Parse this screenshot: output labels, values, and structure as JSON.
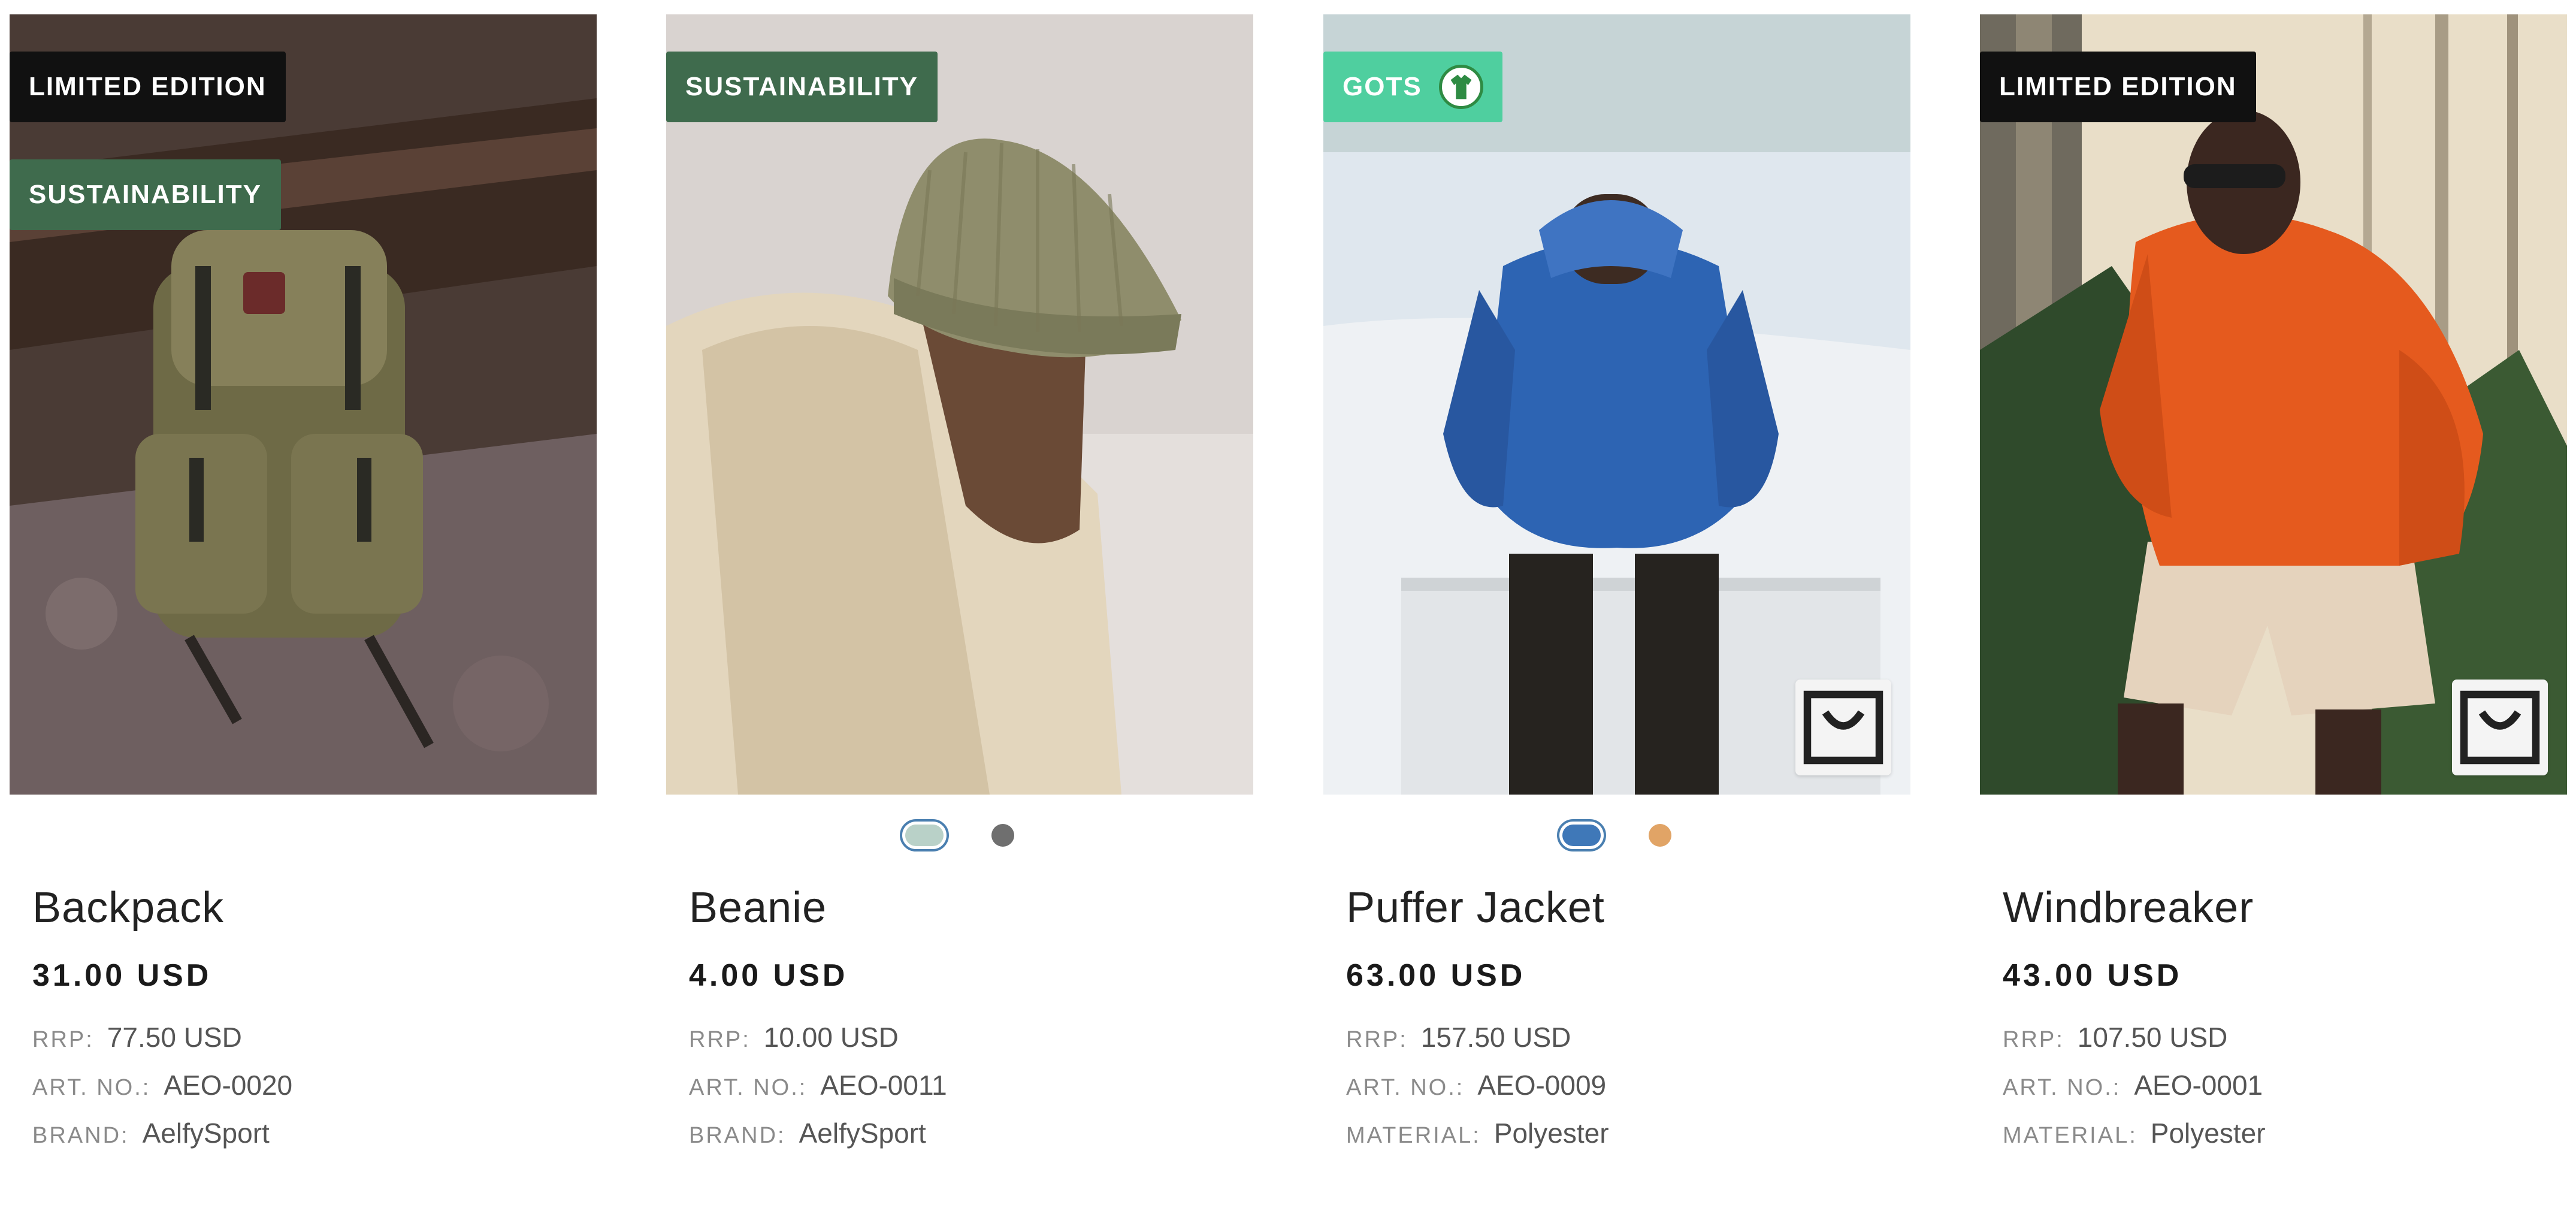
{
  "products": [
    {
      "name": "Backpack",
      "price": "31.00 USD",
      "badges": [
        {
          "label": "LIMITED EDITION",
          "color": "#111111"
        },
        {
          "label": "SUSTAINABILITY",
          "color": "#3f6b4d"
        }
      ],
      "details": [
        {
          "label": "RRP:",
          "value": "77.50 USD"
        },
        {
          "label": "ART. NO.:",
          "value": "AEO-0020"
        },
        {
          "label": "BRAND:",
          "value": "AelfySport"
        }
      ]
    },
    {
      "name": "Beanie",
      "price": "4.00 USD",
      "badges": [
        {
          "label": "SUSTAINABILITY",
          "color": "#3f6b4d"
        }
      ],
      "swatches": [
        "#b9d1c8",
        "#6f6f6f"
      ],
      "details": [
        {
          "label": "RRP:",
          "value": "10.00 USD"
        },
        {
          "label": "ART. NO.:",
          "value": "AEO-0011"
        },
        {
          "label": "BRAND:",
          "value": "AelfySport"
        }
      ]
    },
    {
      "name": "Puffer Jacket",
      "price": "63.00 USD",
      "badges": [
        {
          "label": "GOTS",
          "color": "#4fcf9f",
          "icon": "gots-seal-icon"
        }
      ],
      "swatches": [
        "#3f78b8",
        "#e1a466"
      ],
      "details": [
        {
          "label": "RRP:",
          "value": "157.50 USD"
        },
        {
          "label": "ART. NO.:",
          "value": "AEO-0009"
        },
        {
          "label": "MATERIAL:",
          "value": "Polyester"
        }
      ]
    },
    {
      "name": "Windbreaker",
      "price": "43.00 USD",
      "badges": [
        {
          "label": "LIMITED EDITION",
          "color": "#111111"
        }
      ],
      "details": [
        {
          "label": "RRP:",
          "value": "107.50 USD"
        },
        {
          "label": "ART. NO.:",
          "value": "AEO-0001"
        },
        {
          "label": "MATERIAL:",
          "value": "Polyester"
        }
      ]
    }
  ],
  "icons": {
    "cart": "shopping-bag-icon"
  }
}
